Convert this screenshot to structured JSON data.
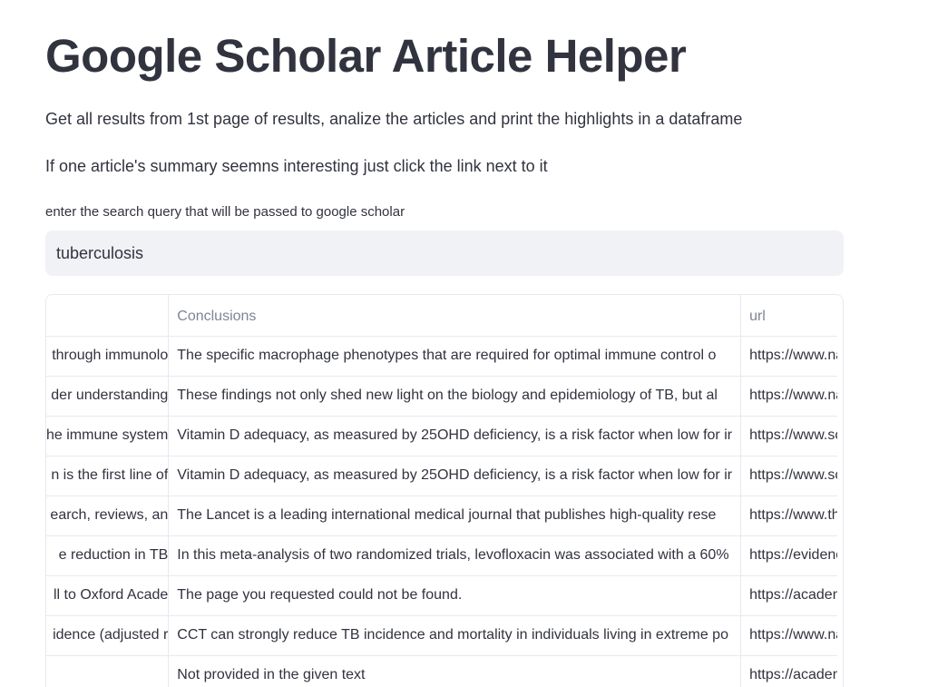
{
  "page": {
    "title": "Google Scholar Article Helper",
    "description": "Get all results from 1st page of results, analize the articles and print the highlights in a dataframe",
    "hint": "If one article's summary seemns interesting just click the link next to it"
  },
  "search": {
    "label": "enter the search query that will be passed to google scholar",
    "value": "tuberculosis"
  },
  "table": {
    "columns": [
      "",
      "Conclusions",
      "url"
    ],
    "rows": [
      {
        "prev": "through immunolo",
        "conclusions": "The specific macrophage phenotypes that are required for optimal immune control o",
        "url": "https://www.na"
      },
      {
        "prev": "der understanding",
        "conclusions": "These findings not only shed new light on the biology and epidemiology of TB, but al",
        "url": "https://www.na"
      },
      {
        "prev": "he immune system",
        "conclusions": "Vitamin D adequacy, as measured by 25OHD deficiency, is a risk factor when low for ir",
        "url": "https://www.sci"
      },
      {
        "prev": "n is the first line of",
        "conclusions": "Vitamin D adequacy, as measured by 25OHD deficiency, is a risk factor when low for ir",
        "url": "https://www.sci"
      },
      {
        "prev": "earch, reviews, an",
        "conclusions": "The Lancet is a leading international medical journal that publishes high-quality rese",
        "url": "https://www.the"
      },
      {
        "prev": "e reduction in TB",
        "conclusions": "In this meta-analysis of two randomized trials, levofloxacin was associated with a 60%",
        "url": "https://evidence"
      },
      {
        "prev": "ll to Oxford Acade",
        "conclusions": "The page you requested could not be found.",
        "url": "https://academi"
      },
      {
        "prev": "idence (adjusted r",
        "conclusions": "CCT can strongly reduce TB incidence and mortality in individuals living in extreme po",
        "url": "https://www.na"
      },
      {
        "prev": "",
        "conclusions": "Not provided in the given text",
        "url": "https://academi"
      }
    ]
  },
  "colors": {
    "text": "#31333f",
    "header_text": "#808495",
    "input_bg": "#f0f2f6",
    "border": "#e6e9ef"
  }
}
